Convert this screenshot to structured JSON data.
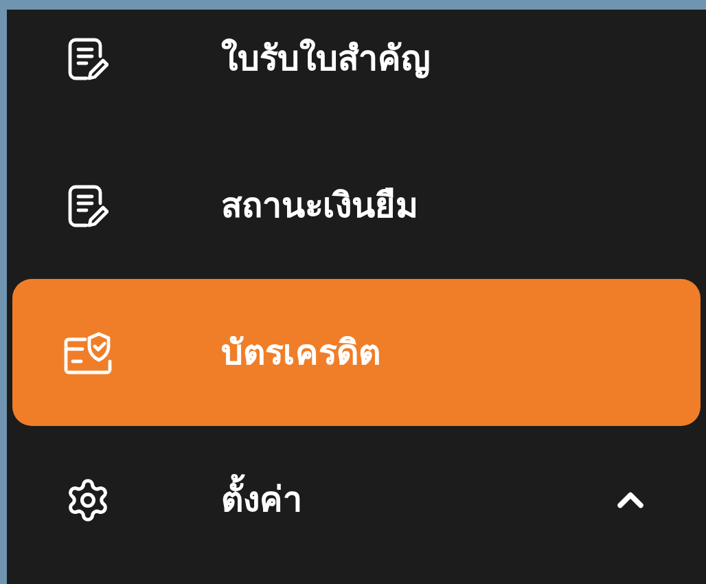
{
  "menu": {
    "items": [
      {
        "label": "ใบรับใบสำคัญ",
        "kind": "document",
        "selected": false
      },
      {
        "label": "สถานะเงินยืม",
        "kind": "document",
        "selected": false
      },
      {
        "label": "บัตรเครดิต",
        "kind": "card",
        "selected": true
      },
      {
        "label": "ตั้งค่า",
        "kind": "settings",
        "selected": false,
        "expanded": true
      }
    ]
  }
}
